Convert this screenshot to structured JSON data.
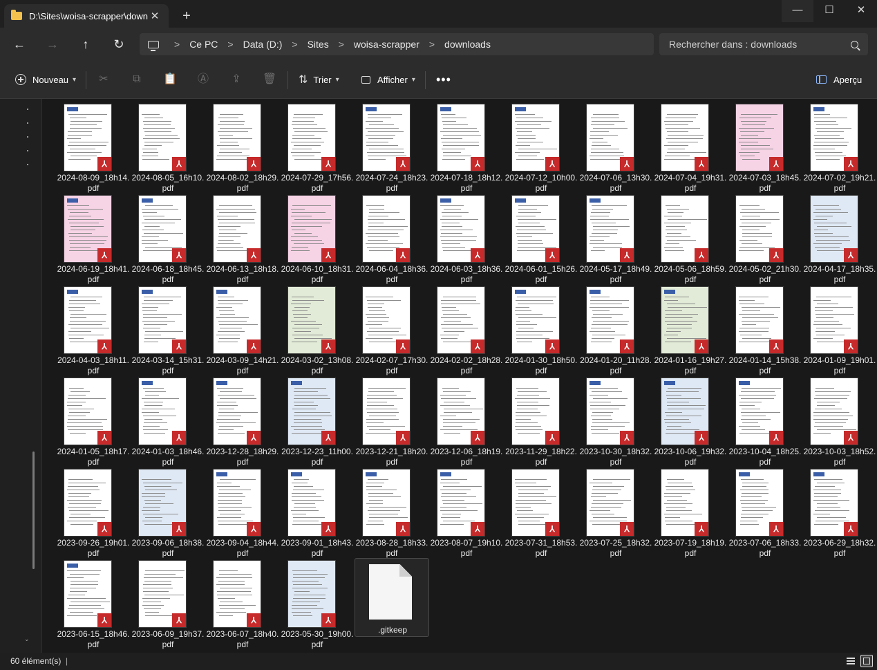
{
  "window": {
    "tab_title": "D:\\Sites\\woisa-scrapper\\down",
    "new_tab_label": "+",
    "minimize_label": "—",
    "maximize_label": "☐",
    "close_label": "✕"
  },
  "nav": {
    "back_label": "←",
    "forward_label": "→",
    "up_label": "↑",
    "refresh_label": "↻"
  },
  "breadcrumb": [
    "Ce PC",
    "Data (D:)",
    "Sites",
    "woisa-scrapper",
    "downloads"
  ],
  "breadcrumb_separator": ">",
  "search": {
    "placeholder": "Rechercher dans : downloads"
  },
  "toolbar": {
    "new_label": "Nouveau",
    "sort_label": "Trier",
    "view_label": "Afficher",
    "more_label": "•••",
    "preview_label": "Aperçu",
    "cut_icon": "✂",
    "copy_icon": "⧉",
    "paste_icon": "📋",
    "rename_icon": "Ⓐ",
    "share_icon": "⇪",
    "delete_icon": "🗑"
  },
  "files": [
    {
      "name": "2024-08-09_18h14.pdf",
      "style": "white"
    },
    {
      "name": "2024-08-05_16h10.pdf",
      "style": "white"
    },
    {
      "name": "2024-08-02_18h29.pdf",
      "style": "white"
    },
    {
      "name": "2024-07-29_17h56.pdf",
      "style": "white"
    },
    {
      "name": "2024-07-24_18h23.pdf",
      "style": "white"
    },
    {
      "name": "2024-07-18_18h12.pdf",
      "style": "white"
    },
    {
      "name": "2024-07-12_10h00.pdf",
      "style": "white"
    },
    {
      "name": "2024-07-06_13h30.pdf",
      "style": "white"
    },
    {
      "name": "2024-07-04_19h31.pdf",
      "style": "white"
    },
    {
      "name": "2024-07-03_18h45.pdf",
      "style": "pink"
    },
    {
      "name": "2024-07-02_19h21.pdf",
      "style": "white"
    },
    {
      "name": "2024-06-19_18h41.pdf",
      "style": "pink"
    },
    {
      "name": "2024-06-18_18h45.pdf",
      "style": "white"
    },
    {
      "name": "2024-06-13_18h18.pdf",
      "style": "white"
    },
    {
      "name": "2024-06-10_18h31.pdf",
      "style": "pink"
    },
    {
      "name": "2024-06-04_18h36.pdf",
      "style": "white"
    },
    {
      "name": "2024-06-03_18h36.pdf",
      "style": "white"
    },
    {
      "name": "2024-06-01_15h26.pdf",
      "style": "white"
    },
    {
      "name": "2024-05-17_18h49.pdf",
      "style": "white"
    },
    {
      "name": "2024-05-06_18h59.pdf",
      "style": "white"
    },
    {
      "name": "2024-05-02_21h30.pdf",
      "style": "white"
    },
    {
      "name": "2024-04-17_18h35.pdf",
      "style": "blue"
    },
    {
      "name": "2024-04-03_18h11.pdf",
      "style": "white"
    },
    {
      "name": "2024-03-14_15h31.pdf",
      "style": "white"
    },
    {
      "name": "2024-03-09_14h21.pdf",
      "style": "white"
    },
    {
      "name": "2024-03-02_13h08.pdf",
      "style": "green"
    },
    {
      "name": "2024-02-07_17h30.pdf",
      "style": "white"
    },
    {
      "name": "2024-02-02_18h28.pdf",
      "style": "white"
    },
    {
      "name": "2024-01-30_18h50.pdf",
      "style": "white"
    },
    {
      "name": "2024-01-20_11h28.pdf",
      "style": "white"
    },
    {
      "name": "2024-01-16_19h27.pdf",
      "style": "green"
    },
    {
      "name": "2024-01-14_15h38.pdf",
      "style": "white"
    },
    {
      "name": "2024-01-09_19h01.pdf",
      "style": "white"
    },
    {
      "name": "2024-01-05_18h17.pdf",
      "style": "white"
    },
    {
      "name": "2024-01-03_18h46.pdf",
      "style": "white"
    },
    {
      "name": "2023-12-28_18h29.pdf",
      "style": "white"
    },
    {
      "name": "2023-12-23_11h00.pdf",
      "style": "blue"
    },
    {
      "name": "2023-12-21_18h20.pdf",
      "style": "white"
    },
    {
      "name": "2023-12-06_18h19.pdf",
      "style": "white"
    },
    {
      "name": "2023-11-29_18h22.pdf",
      "style": "white"
    },
    {
      "name": "2023-10-30_18h32.pdf",
      "style": "white"
    },
    {
      "name": "2023-10-06_19h32.pdf",
      "style": "blue"
    },
    {
      "name": "2023-10-04_18h25.pdf",
      "style": "white"
    },
    {
      "name": "2023-10-03_18h52.pdf",
      "style": "white"
    },
    {
      "name": "2023-09-26_19h01.pdf",
      "style": "white"
    },
    {
      "name": "2023-09-06_18h38.pdf",
      "style": "blue"
    },
    {
      "name": "2023-09-04_18h44.pdf",
      "style": "white"
    },
    {
      "name": "2023-09-01_18h43.pdf",
      "style": "white"
    },
    {
      "name": "2023-08-28_18h33.pdf",
      "style": "white"
    },
    {
      "name": "2023-08-07_19h10.pdf",
      "style": "white"
    },
    {
      "name": "2023-07-31_18h53.pdf",
      "style": "white"
    },
    {
      "name": "2023-07-25_18h32.pdf",
      "style": "white"
    },
    {
      "name": "2023-07-19_18h19.pdf",
      "style": "white"
    },
    {
      "name": "2023-07-06_18h33.pdf",
      "style": "white"
    },
    {
      "name": "2023-06-29_18h32.pdf",
      "style": "white"
    },
    {
      "name": "2023-06-15_18h46.pdf",
      "style": "white"
    },
    {
      "name": "2023-06-09_19h37.pdf",
      "style": "white"
    },
    {
      "name": "2023-06-07_18h40.pdf",
      "style": "white"
    },
    {
      "name": "2023-05-30_19h00.pdf",
      "style": "blue"
    }
  ],
  "generic_file": {
    "name": ".gitkeep"
  },
  "status": {
    "count": "60 élément(s)",
    "separator": "|"
  },
  "colors": {
    "accent": "#8ab4f8",
    "pdf_badge": "#c62a2a",
    "folder": "#f2c14e"
  }
}
